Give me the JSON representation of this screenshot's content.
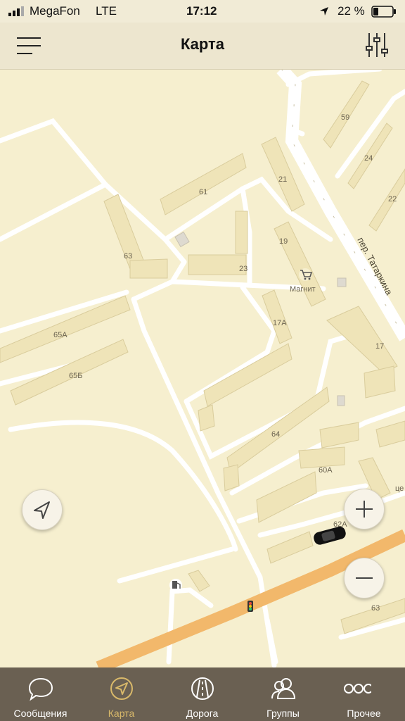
{
  "status_bar": {
    "carrier": "MegaFon",
    "network": "LTE",
    "time": "17:12",
    "battery": "22 %"
  },
  "header": {
    "title": "Карта",
    "menu_icon": "hamburger-icon",
    "settings_icon": "sliders-icon"
  },
  "map": {
    "labels": {
      "b59": "59",
      "b24": "24",
      "b22": "22",
      "b21": "21",
      "b61": "61",
      "b63": "63",
      "b23": "23",
      "b19": "19",
      "shop": "Магнит",
      "street": "пер. Татаркина",
      "b17a": "17А",
      "b17": "17",
      "b65a": "65А",
      "b65b": "65Б",
      "b64": "64",
      "b60a": "60А",
      "b62a": "62А",
      "b63b": "63",
      "cut": "це"
    }
  },
  "controls": {
    "locate_icon": "location-arrow-icon",
    "zoom_in_icon": "plus-icon",
    "zoom_out_icon": "minus-icon"
  },
  "tabs": [
    {
      "label": "Сообщения",
      "icon": "chat-bubble-icon"
    },
    {
      "label": "Карта",
      "icon": "compass-arrow-icon"
    },
    {
      "label": "Дорога",
      "icon": "road-icon"
    },
    {
      "label": "Группы",
      "icon": "group-icon"
    },
    {
      "label": "Прочее",
      "icon": "more-dots-icon"
    }
  ],
  "colors": {
    "tabbar_bg": "#6a6052",
    "active_tab": "#d9b96a",
    "map_bg": "#f6efcf",
    "building": "#efe4b8",
    "main_road": "#f2b86b"
  }
}
